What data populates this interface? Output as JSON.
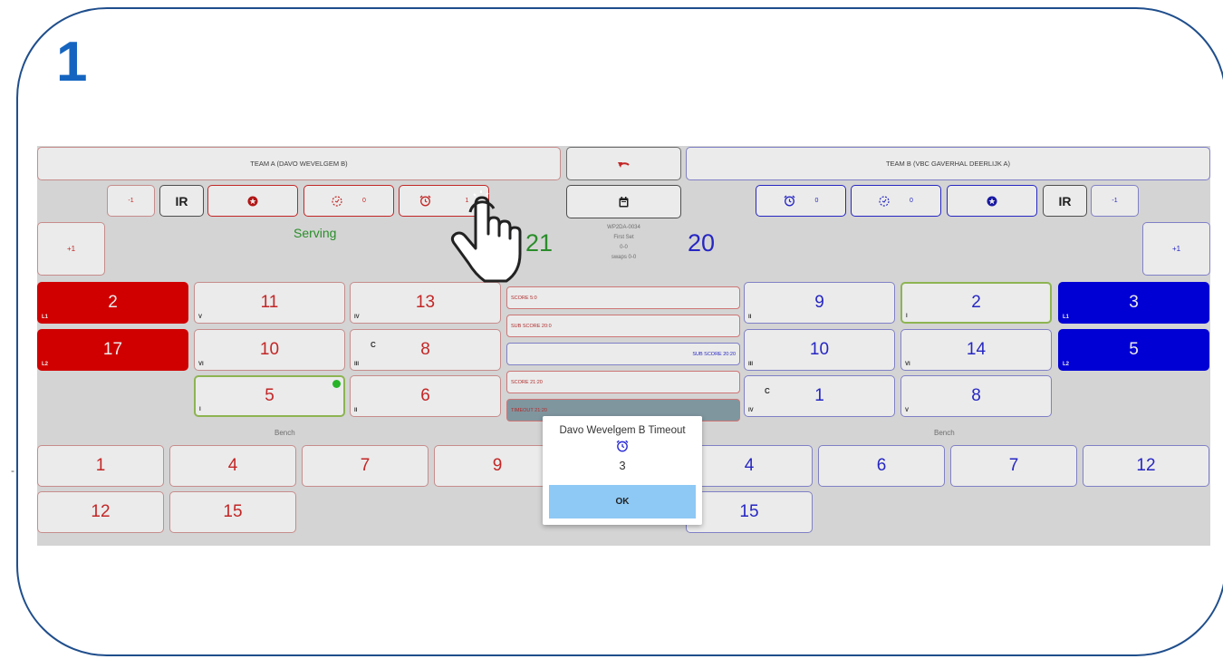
{
  "step_number": "1",
  "side_mark": "-",
  "team_a": {
    "name": "TEAM A (DAVO WEVELGEM B)",
    "minus_label": "-1",
    "ir_label": "IR",
    "sub_count": "0",
    "timeout_count": "1",
    "plus_label": "+1",
    "serving_label": "Serving",
    "score": "21",
    "court": [
      {
        "num": "2",
        "roman": "L1",
        "style": "libero"
      },
      {
        "num": "11",
        "roman": "V"
      },
      {
        "num": "13",
        "roman": "IV"
      },
      {
        "num": "17",
        "roman": "L2",
        "style": "libero"
      },
      {
        "num": "10",
        "roman": "VI"
      },
      {
        "num": "8",
        "roman": "III",
        "captain": "C"
      },
      {
        "num": "5",
        "roman": "I",
        "selected": true
      },
      {
        "num": "6",
        "roman": "II"
      }
    ],
    "bench_label": "Bench",
    "bench": [
      "1",
      "4",
      "7",
      "9",
      "12",
      "15"
    ]
  },
  "team_b": {
    "name": "TEAM B (VBC GAVERHAL DEERLIJK A)",
    "minus_label": "-1",
    "ir_label": "IR",
    "sub_count": "0",
    "timeout_count": "0",
    "plus_label": "+1",
    "score": "20",
    "court": [
      {
        "num": "9",
        "roman": "II"
      },
      {
        "num": "2",
        "roman": "I",
        "selected": true
      },
      {
        "num": "3",
        "roman": "L1",
        "style": "libero"
      },
      {
        "num": "10",
        "roman": "III"
      },
      {
        "num": "14",
        "roman": "VI"
      },
      {
        "num": "5",
        "roman": "L2",
        "style": "libero"
      },
      {
        "num": "1",
        "roman": "IV",
        "captain": "C"
      },
      {
        "num": "8",
        "roman": "V"
      }
    ],
    "bench_label": "Bench",
    "bench": [
      "4",
      "6",
      "7",
      "12",
      "15"
    ]
  },
  "match": {
    "code": "WP2DA-0034",
    "set": "First Set",
    "sets_score": "0-0",
    "swaps": "swaps 0-0"
  },
  "events": [
    {
      "text": "SCORE 5:0",
      "team": "a"
    },
    {
      "text": "SUB SCORE 20:0",
      "team": "a"
    },
    {
      "text": "SUB SCORE 20:20",
      "team": "b"
    },
    {
      "text": "SCORE 21:20",
      "team": "a"
    },
    {
      "text": "TIMEOUT 21:20",
      "team": "a"
    }
  ],
  "dialog": {
    "title": "Davo Wevelgem B Timeout",
    "count": "3",
    "ok_label": "OK"
  },
  "colors": {
    "team_a": "#d42a2a",
    "team_b": "#2a2ad4",
    "libero_a": "#e20000",
    "libero_b": "#0000e8",
    "serving": "#2e9a2e",
    "frame": "#1f4e8c",
    "ok_button": "#8ec9f5"
  },
  "icons": [
    "undo-icon",
    "calendar-icon",
    "sub-icon",
    "alarm-icon",
    "card-icon",
    "pointer-hand-icon"
  ]
}
